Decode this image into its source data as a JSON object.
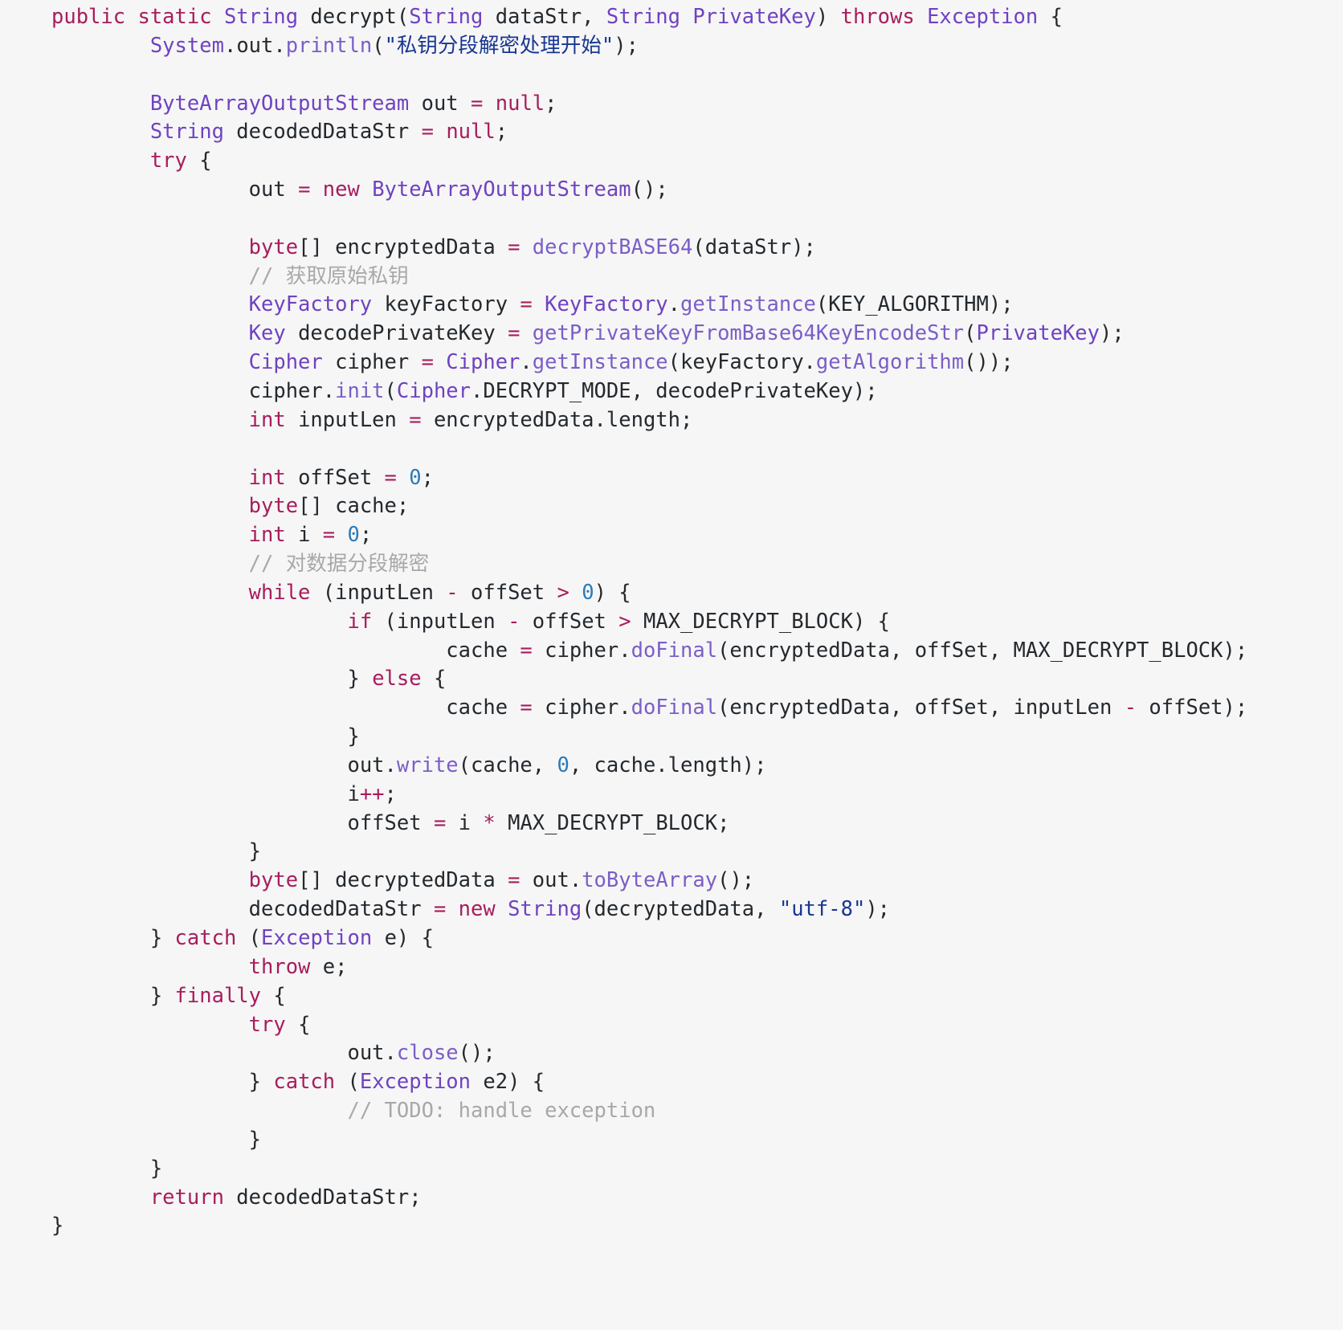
{
  "editor": {
    "language": "java",
    "background_color": "#f6f6f6",
    "font_size_px": 25.5,
    "line_height_px": 35.85,
    "palette": {
      "keyword": "#a71d5d",
      "type": "#6f42c1",
      "function": "#7b5ec7",
      "number": "#2b7bb9",
      "string": "#183691",
      "comment": "#a8a8a8",
      "operator": "#a71d5d",
      "plain": "#24292e"
    }
  },
  "code": {
    "lines": [
      "public static String decrypt(String dataStr, String PrivateKey) throws Exception {",
      "        System.out.println(\"私钥分段解密处理开始\");",
      "",
      "        ByteArrayOutputStream out = null;",
      "        String decodedDataStr = null;",
      "        try {",
      "                out = new ByteArrayOutputStream();",
      "",
      "                byte[] encryptedData = decryptBASE64(dataStr);",
      "                // 获取原始私钥",
      "                KeyFactory keyFactory = KeyFactory.getInstance(KEY_ALGORITHM);",
      "                Key decodePrivateKey = getPrivateKeyFromBase64KeyEncodeStr(PrivateKey);",
      "                Cipher cipher = Cipher.getInstance(keyFactory.getAlgorithm());",
      "                cipher.init(Cipher.DECRYPT_MODE, decodePrivateKey);",
      "                int inputLen = encryptedData.length;",
      "",
      "                int offSet = 0;",
      "                byte[] cache;",
      "                int i = 0;",
      "                // 对数据分段解密",
      "                while (inputLen - offSet > 0) {",
      "                        if (inputLen - offSet > MAX_DECRYPT_BLOCK) {",
      "                                cache = cipher.doFinal(encryptedData, offSet, MAX_DECRYPT_BLOCK);",
      "                        } else {",
      "                                cache = cipher.doFinal(encryptedData, offSet, inputLen - offSet);",
      "                        }",
      "                        out.write(cache, 0, cache.length);",
      "                        i++;",
      "                        offSet = i * MAX_DECRYPT_BLOCK;",
      "                }",
      "                byte[] decryptedData = out.toByteArray();",
      "                decodedDataStr = new String(decryptedData, \"utf-8\");",
      "        } catch (Exception e) {",
      "                throw e;",
      "        } finally {",
      "                try {",
      "                        out.close();",
      "                } catch (Exception e2) {",
      "                        // TODO: handle exception",
      "                }",
      "        }",
      "        return decodedDataStr;",
      "}"
    ],
    "tokens": [
      [
        [
          "public ",
          "kw"
        ],
        [
          "static ",
          "kw"
        ],
        [
          "String ",
          "typ"
        ],
        [
          "decrypt",
          "pln"
        ],
        [
          "(",
          "pln"
        ],
        [
          "String ",
          "typ"
        ],
        [
          "dataStr, ",
          "pln"
        ],
        [
          "String ",
          "typ"
        ],
        [
          "PrivateKey",
          "typ"
        ],
        [
          ") ",
          "pln"
        ],
        [
          "throws ",
          "kw"
        ],
        [
          "Exception ",
          "typ"
        ],
        [
          "{",
          "pln"
        ]
      ],
      [
        [
          "        ",
          "pln"
        ],
        [
          "System",
          "typ"
        ],
        [
          ".",
          "pln"
        ],
        [
          "out",
          "pln"
        ],
        [
          ".",
          "pln"
        ],
        [
          "println",
          "fn"
        ],
        [
          "(",
          "pln"
        ],
        [
          "\"私钥分段解密处理开始\"",
          "str"
        ],
        [
          ");",
          "pln"
        ]
      ],
      [
        [
          "",
          ""
        ]
      ],
      [
        [
          "        ",
          "pln"
        ],
        [
          "ByteArrayOutputStream ",
          "typ"
        ],
        [
          "out ",
          "pln"
        ],
        [
          "= ",
          "op"
        ],
        [
          "null",
          "kw"
        ],
        [
          ";",
          "pln"
        ]
      ],
      [
        [
          "        ",
          "pln"
        ],
        [
          "String ",
          "typ"
        ],
        [
          "decodedDataStr ",
          "pln"
        ],
        [
          "= ",
          "op"
        ],
        [
          "null",
          "kw"
        ],
        [
          ";",
          "pln"
        ]
      ],
      [
        [
          "        ",
          "pln"
        ],
        [
          "try ",
          "kw"
        ],
        [
          "{",
          "pln"
        ]
      ],
      [
        [
          "                ",
          "pln"
        ],
        [
          "out ",
          "pln"
        ],
        [
          "= ",
          "op"
        ],
        [
          "new ",
          "kw"
        ],
        [
          "ByteArrayOutputStream",
          "typ"
        ],
        [
          "();",
          "pln"
        ]
      ],
      [
        [
          "",
          ""
        ]
      ],
      [
        [
          "                ",
          "pln"
        ],
        [
          "byte",
          "kw"
        ],
        [
          "[] encryptedData ",
          "pln"
        ],
        [
          "= ",
          "op"
        ],
        [
          "decryptBASE64",
          "fn"
        ],
        [
          "(dataStr);",
          "pln"
        ]
      ],
      [
        [
          "                ",
          "pln"
        ],
        [
          "// 获取原始私钥",
          "cmt"
        ]
      ],
      [
        [
          "                ",
          "pln"
        ],
        [
          "KeyFactory ",
          "typ"
        ],
        [
          "keyFactory ",
          "pln"
        ],
        [
          "= ",
          "op"
        ],
        [
          "KeyFactory",
          "typ"
        ],
        [
          ".",
          "pln"
        ],
        [
          "getInstance",
          "fn"
        ],
        [
          "(KEY_ALGORITHM);",
          "pln"
        ]
      ],
      [
        [
          "                ",
          "pln"
        ],
        [
          "Key ",
          "typ"
        ],
        [
          "decodePrivateKey ",
          "pln"
        ],
        [
          "= ",
          "op"
        ],
        [
          "getPrivateKeyFromBase64KeyEncodeStr",
          "fn"
        ],
        [
          "(",
          "pln"
        ],
        [
          "PrivateKey",
          "typ"
        ],
        [
          ");",
          "pln"
        ]
      ],
      [
        [
          "                ",
          "pln"
        ],
        [
          "Cipher ",
          "typ"
        ],
        [
          "cipher ",
          "pln"
        ],
        [
          "= ",
          "op"
        ],
        [
          "Cipher",
          "typ"
        ],
        [
          ".",
          "pln"
        ],
        [
          "getInstance",
          "fn"
        ],
        [
          "(keyFactory.",
          "pln"
        ],
        [
          "getAlgorithm",
          "fn"
        ],
        [
          "());",
          "pln"
        ]
      ],
      [
        [
          "                ",
          "pln"
        ],
        [
          "cipher.",
          "pln"
        ],
        [
          "init",
          "fn"
        ],
        [
          "(",
          "pln"
        ],
        [
          "Cipher",
          "typ"
        ],
        [
          ".DECRYPT_MODE, decodePrivateKey);",
          "pln"
        ]
      ],
      [
        [
          "                ",
          "pln"
        ],
        [
          "int ",
          "kw"
        ],
        [
          "inputLen ",
          "pln"
        ],
        [
          "= ",
          "op"
        ],
        [
          "encryptedData.length;",
          "pln"
        ]
      ],
      [
        [
          "",
          ""
        ]
      ],
      [
        [
          "                ",
          "pln"
        ],
        [
          "int ",
          "kw"
        ],
        [
          "offSet ",
          "pln"
        ],
        [
          "= ",
          "op"
        ],
        [
          "0",
          "num"
        ],
        [
          ";",
          "pln"
        ]
      ],
      [
        [
          "                ",
          "pln"
        ],
        [
          "byte",
          "kw"
        ],
        [
          "[] cache;",
          "pln"
        ]
      ],
      [
        [
          "                ",
          "pln"
        ],
        [
          "int ",
          "kw"
        ],
        [
          "i ",
          "pln"
        ],
        [
          "= ",
          "op"
        ],
        [
          "0",
          "num"
        ],
        [
          ";",
          "pln"
        ]
      ],
      [
        [
          "                ",
          "pln"
        ],
        [
          "// 对数据分段解密",
          "cmt"
        ]
      ],
      [
        [
          "                ",
          "pln"
        ],
        [
          "while ",
          "kw"
        ],
        [
          "(inputLen ",
          "pln"
        ],
        [
          "- ",
          "op"
        ],
        [
          "offSet ",
          "pln"
        ],
        [
          "> ",
          "op"
        ],
        [
          "0",
          "num"
        ],
        [
          ") {",
          "pln"
        ]
      ],
      [
        [
          "                        ",
          "pln"
        ],
        [
          "if ",
          "kw"
        ],
        [
          "(inputLen ",
          "pln"
        ],
        [
          "- ",
          "op"
        ],
        [
          "offSet ",
          "pln"
        ],
        [
          "> ",
          "op"
        ],
        [
          "MAX_DECRYPT_BLOCK) {",
          "pln"
        ]
      ],
      [
        [
          "                                ",
          "pln"
        ],
        [
          "cache ",
          "pln"
        ],
        [
          "= ",
          "op"
        ],
        [
          "cipher.",
          "pln"
        ],
        [
          "doFinal",
          "fn"
        ],
        [
          "(encryptedData, offSet, MAX_DECRYPT_BLOCK);",
          "pln"
        ]
      ],
      [
        [
          "                        ",
          "pln"
        ],
        [
          "} ",
          "pln"
        ],
        [
          "else ",
          "kw"
        ],
        [
          "{",
          "pln"
        ]
      ],
      [
        [
          "                                ",
          "pln"
        ],
        [
          "cache ",
          "pln"
        ],
        [
          "= ",
          "op"
        ],
        [
          "cipher.",
          "pln"
        ],
        [
          "doFinal",
          "fn"
        ],
        [
          "(encryptedData, offSet, inputLen ",
          "pln"
        ],
        [
          "- ",
          "op"
        ],
        [
          "offSet);",
          "pln"
        ]
      ],
      [
        [
          "                        ",
          "pln"
        ],
        [
          "}",
          "pln"
        ]
      ],
      [
        [
          "                        ",
          "pln"
        ],
        [
          "out.",
          "pln"
        ],
        [
          "write",
          "fn"
        ],
        [
          "(cache, ",
          "pln"
        ],
        [
          "0",
          "num"
        ],
        [
          ", cache.length);",
          "pln"
        ]
      ],
      [
        [
          "                        ",
          "pln"
        ],
        [
          "i",
          "pln"
        ],
        [
          "++",
          "op"
        ],
        [
          ";",
          "pln"
        ]
      ],
      [
        [
          "                        ",
          "pln"
        ],
        [
          "offSet ",
          "pln"
        ],
        [
          "= ",
          "op"
        ],
        [
          "i ",
          "pln"
        ],
        [
          "* ",
          "op"
        ],
        [
          "MAX_DECRYPT_BLOCK;",
          "pln"
        ]
      ],
      [
        [
          "                ",
          "pln"
        ],
        [
          "}",
          "pln"
        ]
      ],
      [
        [
          "                ",
          "pln"
        ],
        [
          "byte",
          "kw"
        ],
        [
          "[] decryptedData ",
          "pln"
        ],
        [
          "= ",
          "op"
        ],
        [
          "out.",
          "pln"
        ],
        [
          "toByteArray",
          "fn"
        ],
        [
          "();",
          "pln"
        ]
      ],
      [
        [
          "                ",
          "pln"
        ],
        [
          "decodedDataStr ",
          "pln"
        ],
        [
          "= ",
          "op"
        ],
        [
          "new ",
          "kw"
        ],
        [
          "String",
          "typ"
        ],
        [
          "(decryptedData, ",
          "pln"
        ],
        [
          "\"utf-8\"",
          "str"
        ],
        [
          ");",
          "pln"
        ]
      ],
      [
        [
          "        ",
          "pln"
        ],
        [
          "} ",
          "pln"
        ],
        [
          "catch ",
          "kw"
        ],
        [
          "(",
          "pln"
        ],
        [
          "Exception ",
          "typ"
        ],
        [
          "e) {",
          "pln"
        ]
      ],
      [
        [
          "                ",
          "pln"
        ],
        [
          "throw ",
          "kw"
        ],
        [
          "e;",
          "pln"
        ]
      ],
      [
        [
          "        ",
          "pln"
        ],
        [
          "} ",
          "pln"
        ],
        [
          "finally ",
          "kw"
        ],
        [
          "{",
          "pln"
        ]
      ],
      [
        [
          "                ",
          "pln"
        ],
        [
          "try ",
          "kw"
        ],
        [
          "{",
          "pln"
        ]
      ],
      [
        [
          "                        ",
          "pln"
        ],
        [
          "out.",
          "pln"
        ],
        [
          "close",
          "fn"
        ],
        [
          "();",
          "pln"
        ]
      ],
      [
        [
          "                ",
          "pln"
        ],
        [
          "} ",
          "pln"
        ],
        [
          "catch ",
          "kw"
        ],
        [
          "(",
          "pln"
        ],
        [
          "Exception ",
          "typ"
        ],
        [
          "e2) {",
          "pln"
        ]
      ],
      [
        [
          "                        ",
          "pln"
        ],
        [
          "// TODO: handle exception",
          "cmt"
        ]
      ],
      [
        [
          "                ",
          "pln"
        ],
        [
          "}",
          "pln"
        ]
      ],
      [
        [
          "        ",
          "pln"
        ],
        [
          "}",
          "pln"
        ]
      ],
      [
        [
          "        ",
          "pln"
        ],
        [
          "return ",
          "kw"
        ],
        [
          "decodedDataStr;",
          "pln"
        ]
      ],
      [
        [
          "}",
          "pln"
        ]
      ]
    ]
  }
}
